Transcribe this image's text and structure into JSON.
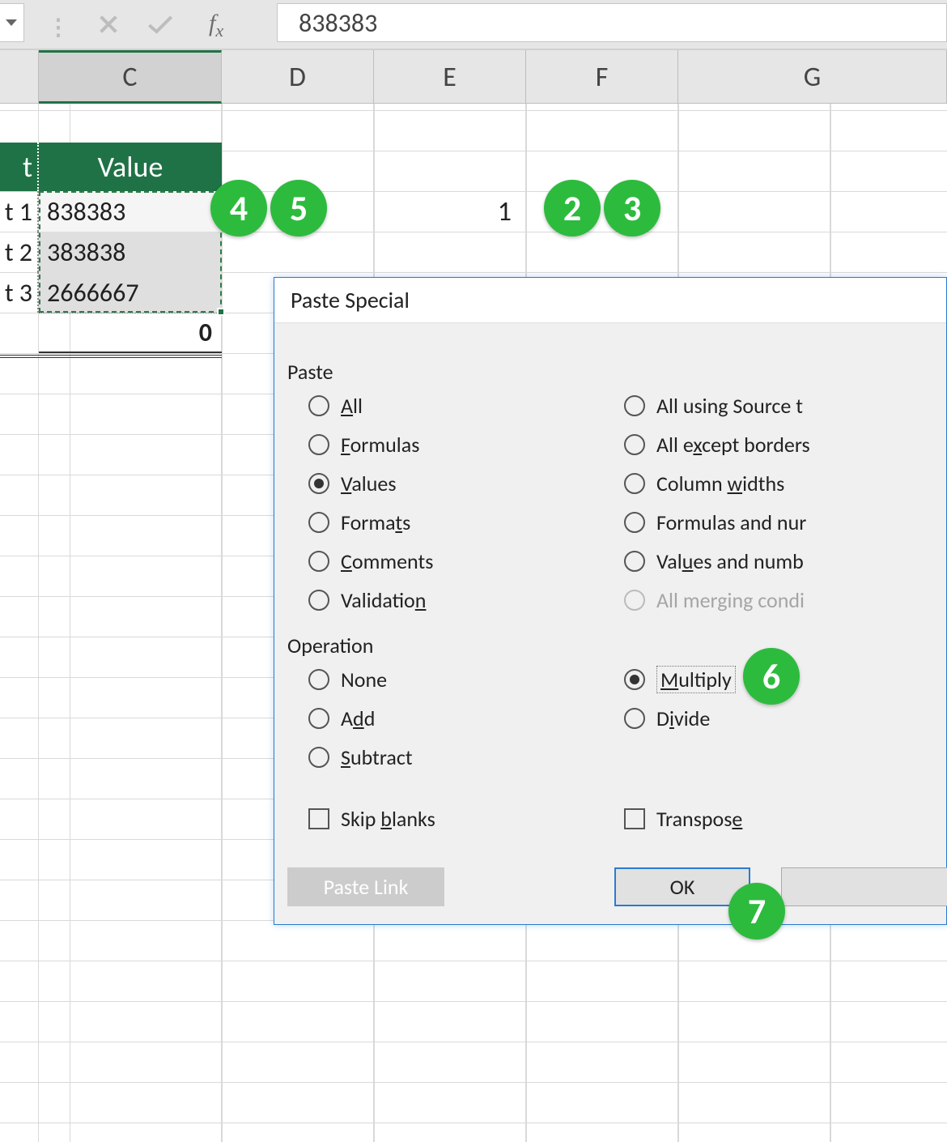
{
  "formula_bar": {
    "fx_label_main": "f",
    "fx_label_sub": "x",
    "value": "838383"
  },
  "columns": {
    "c": "C",
    "d": "D",
    "e": "E",
    "f": "F",
    "g": "G"
  },
  "table": {
    "header_b": "t",
    "header_c": "Value",
    "rows": [
      {
        "b": "t 1",
        "c": "838383"
      },
      {
        "b": "t 2",
        "c": "383838"
      },
      {
        "b": "t 3",
        "c": "2666667"
      }
    ],
    "total_c": "0"
  },
  "cell_e": "1",
  "dialog": {
    "title": "Paste Special",
    "group_paste": "Paste",
    "group_operation": "Operation",
    "paste_left": [
      {
        "pre": "",
        "u": "A",
        "post": "ll"
      },
      {
        "pre": "",
        "u": "F",
        "post": "ormulas"
      },
      {
        "pre": "",
        "u": "V",
        "post": "alues"
      },
      {
        "pre": "Forma",
        "u": "t",
        "post": "s"
      },
      {
        "pre": "",
        "u": "C",
        "post": "omments"
      },
      {
        "pre": "Validatio",
        "u": "n",
        "post": ""
      }
    ],
    "paste_right": [
      {
        "text": "All using Source t"
      },
      {
        "pre": "All e",
        "u": "x",
        "post": "cept borders"
      },
      {
        "pre": "Column ",
        "u": "w",
        "post": "idths"
      },
      {
        "text": "Formulas and nur"
      },
      {
        "pre": "Val",
        "u": "u",
        "post": "es and numb"
      },
      {
        "text": "All merging condi"
      }
    ],
    "op_left": [
      {
        "text": "None"
      },
      {
        "pre": "A",
        "u": "d",
        "post": "d"
      },
      {
        "pre": "",
        "u": "S",
        "post": "ubtract"
      }
    ],
    "op_right": [
      {
        "pre": "",
        "u": "M",
        "post": "ultiply"
      },
      {
        "pre": "D",
        "u": "i",
        "post": "vide"
      }
    ],
    "skip_blanks_pre": "Skip ",
    "skip_blanks_u": "b",
    "skip_blanks_post": "lanks",
    "transpose_pre": "Transpos",
    "transpose_u": "e",
    "transpose_post": "",
    "paste_link": "Paste Link",
    "ok": "OK"
  },
  "badges": {
    "b2": "2",
    "b3": "3",
    "b4": "4",
    "b5": "5",
    "b6": "6",
    "b7": "7"
  }
}
